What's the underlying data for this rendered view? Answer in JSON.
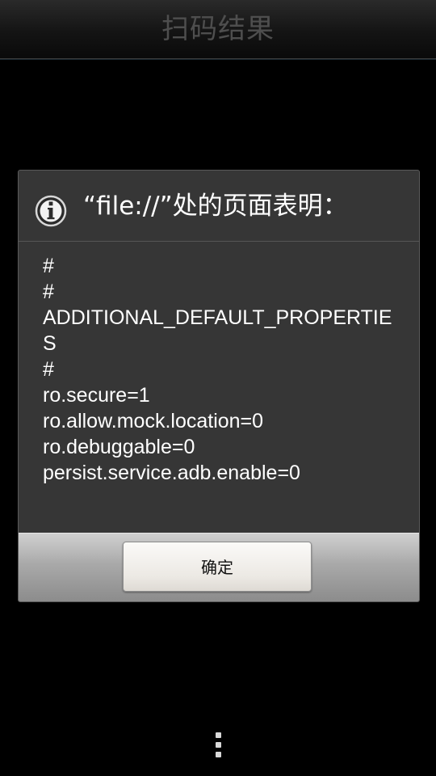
{
  "titlebar": {
    "title": "扫码结果"
  },
  "dialog": {
    "title": "“file://”处的页面表明：",
    "icon": "info-icon",
    "lines": [
      "#",
      "#",
      "ADDITIONAL_DEFAULT_PROPERTIE",
      "S",
      "#",
      "ro.secure=1",
      "ro.allow.mock.location=0",
      "ro.debuggable=0",
      "persist.service.adb.enable=0"
    ],
    "ok_label": "确定"
  },
  "bottom_bar": {
    "icon": "overflow-menu-icon"
  },
  "colors": {
    "background": "#000000",
    "dialog_bg": "#363636",
    "title_text": "#4e4e4e"
  }
}
